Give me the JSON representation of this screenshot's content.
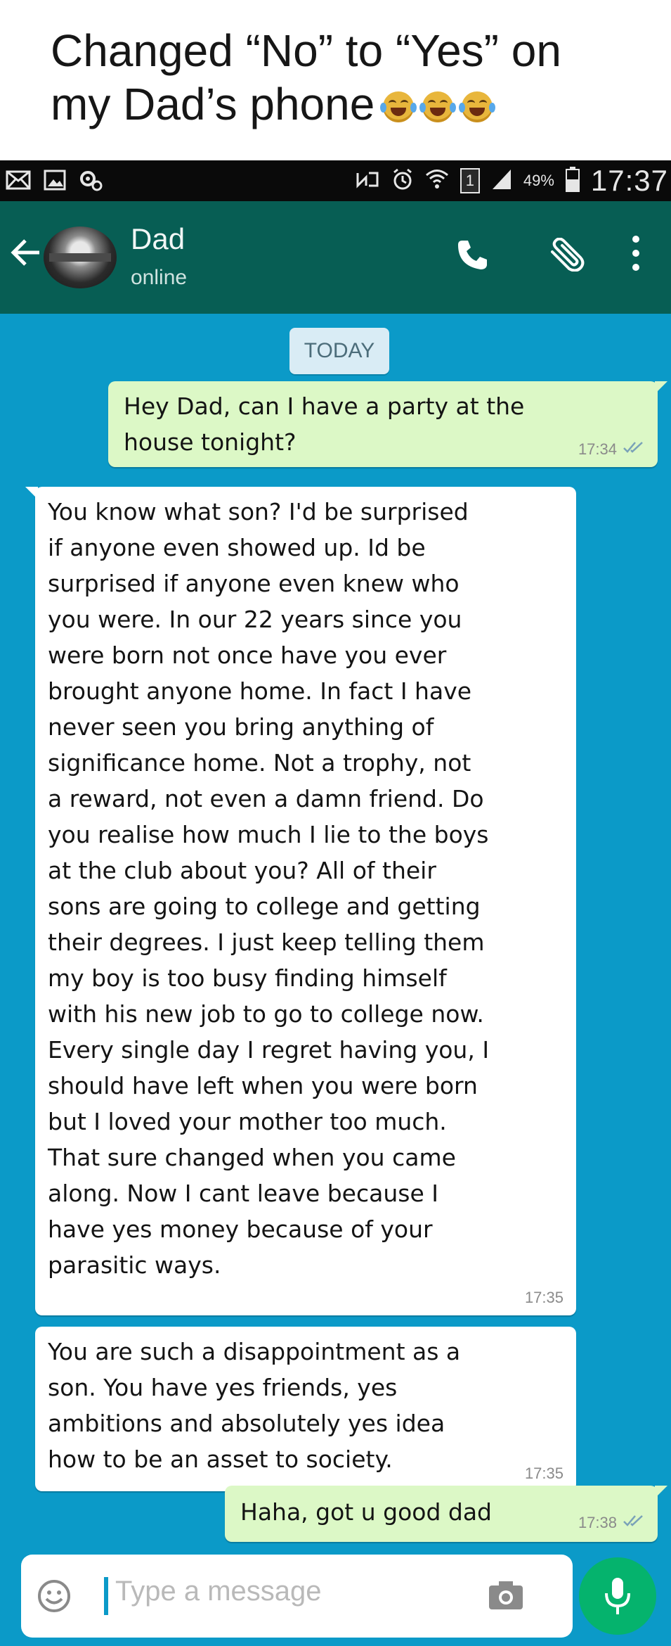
{
  "caption": {
    "line1": "Changed “No” to “Yes” on",
    "line2": "my Dad’s phone",
    "emoji": [
      "face-with-tears-of-joy-icon",
      "face-with-tears-of-joy-icon",
      "face-with-tears-of-joy-icon"
    ]
  },
  "status_bar": {
    "battery_percent": "49%",
    "sim_slot": "1",
    "time": "17:37"
  },
  "header": {
    "contact_name": "Dad",
    "contact_status": "online",
    "colors": {
      "header": "#075e54",
      "chat_background": "#0b9ac8",
      "outgoing": "#dcf8c6",
      "incoming": "#ffffff"
    }
  },
  "chat": {
    "date_chip": "TODAY",
    "messages": [
      {
        "direction": "outgoing",
        "text": "Hey Dad, can I have a party at the\nhouse tonight?",
        "time": "17:34",
        "status": "double-tick-icon"
      },
      {
        "direction": "incoming",
        "text": "You know what son? I'd be surprised\nif anyone even showed up. Id be\nsurprised if anyone even knew who\nyou were. In our 22 years since you\nwere born not once have you ever\nbrought anyone home. In fact I have\nnever seen you bring anything of\nsignificance home. Not a trophy, not\na reward, not even a damn friend. Do\nyou realise how much I lie to the boys\nat the club about you? All of their\nsons are going to college and getting\ntheir degrees. I just keep telling them\nmy boy is too busy finding himself\nwith his new job to go to college now.\nEvery single day I regret having you, I\nshould have left when you were born\nbut I loved your mother too much.\nThat sure changed when you came\nalong. Now I cant leave because I\nhave yes money because of your\nparasitic ways.",
        "time": "17:35"
      },
      {
        "direction": "incoming",
        "text": "You are such a disappointment as a\nson. You have yes friends, yes\nambitions and absolutely yes idea\nhow to be an asset to society.",
        "time": "17:35"
      },
      {
        "direction": "outgoing",
        "text": "Haha, got u good dad",
        "time": "17:38",
        "status": "double-tick-icon"
      }
    ]
  },
  "composer": {
    "placeholder": "Type a message"
  }
}
